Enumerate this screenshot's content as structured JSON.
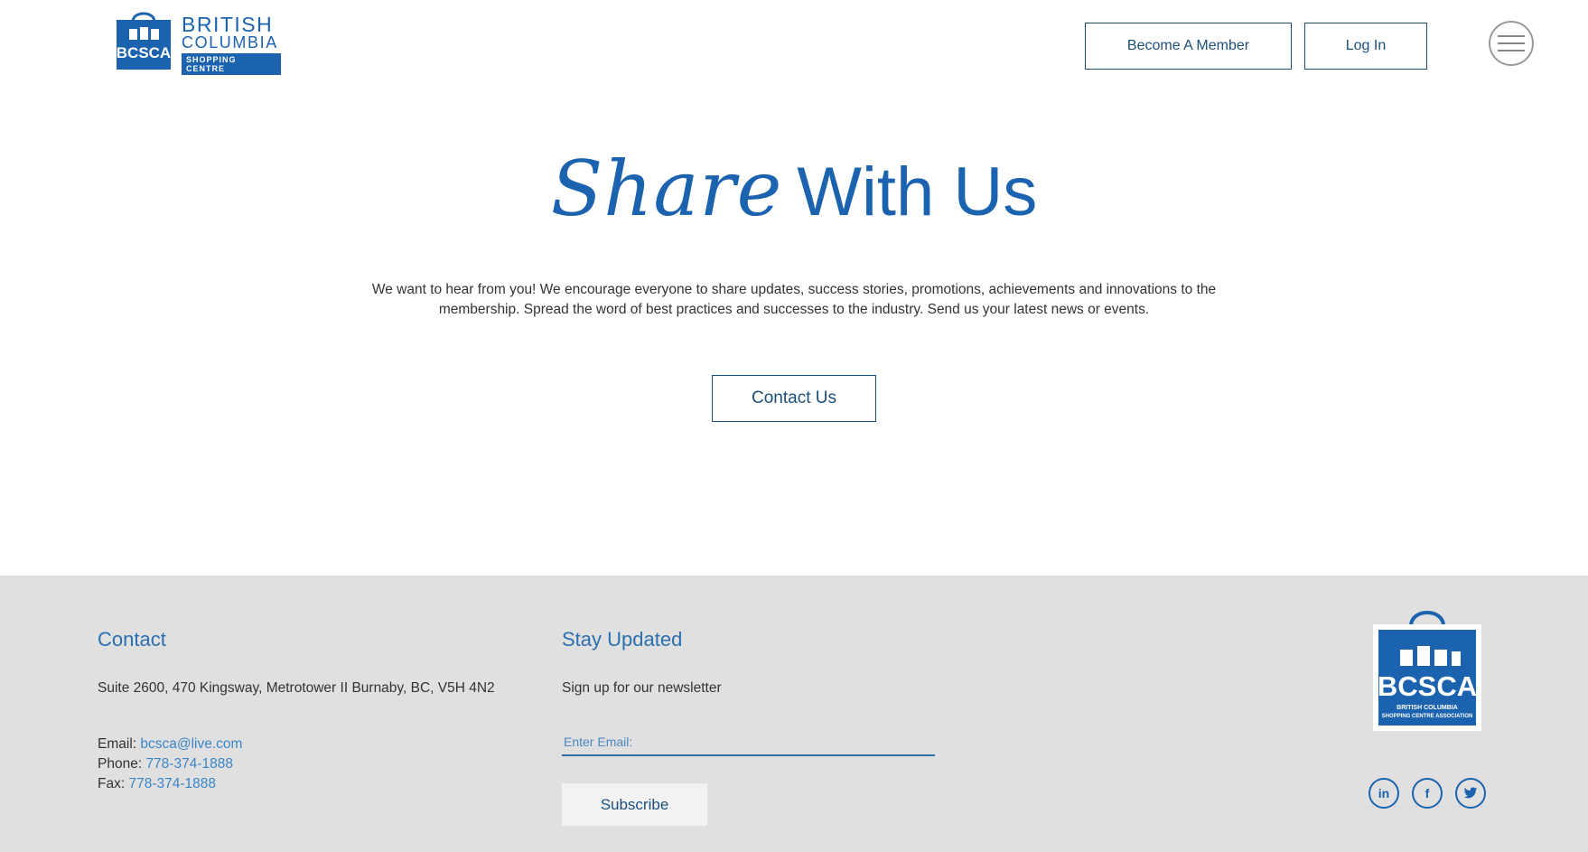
{
  "header": {
    "logo": {
      "bag_text": "BCSCA",
      "line1": "BRITISH",
      "line2": "COLUMBIA",
      "line3": "SHOPPING CENTRE"
    },
    "become_member_label": "Become A Member",
    "login_label": "Log In",
    "menu_icon": "hamburger-icon"
  },
  "hero": {
    "title_script": "Share",
    "title_plain": "With Us",
    "text": "We want to hear from you! We encourage everyone to share updates, success stories, promotions, achievements and innovations to the membership. Spread the word of best practices and successes to the industry. Send us your latest news or events.",
    "contact_button_label": "Contact Us"
  },
  "footer": {
    "contact": {
      "heading": "Contact",
      "address": "Suite 2600, 470 Kingsway, Metrotower II Burnaby, BC, V5H 4N2",
      "email_label": "Email: ",
      "email": "bcsca@live.com",
      "phone_label": "Phone: ",
      "phone": "778-374-1888",
      "fax_label": "Fax: ",
      "fax": "778-374-1888"
    },
    "stay_updated": {
      "heading": "Stay Updated",
      "text": "Sign up for our newsletter",
      "email_placeholder": "Enter Email:",
      "subscribe_label": "Subscribe"
    },
    "badge": {
      "title": "BCSCA",
      "subtitle1": "BRITISH COLUMBIA",
      "subtitle2": "SHOPPING CENTRE ASSOCIATION"
    },
    "social": {
      "linkedin": "in",
      "facebook": "f"
    }
  },
  "colors": {
    "brand_blue": "#1b63ae",
    "dark_blue": "#1b4f7a",
    "footer_bg": "#e0e0e0",
    "link_blue": "#3b86c8"
  }
}
